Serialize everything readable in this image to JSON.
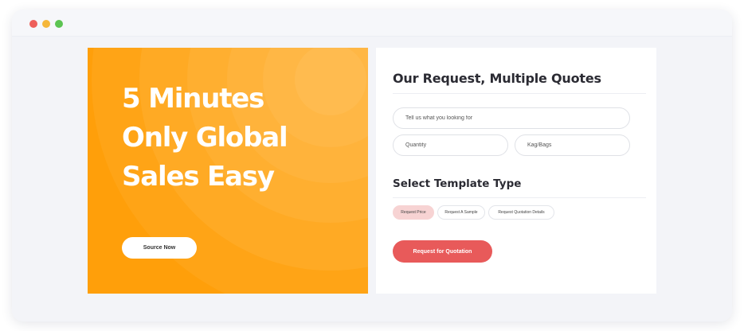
{
  "window": {
    "traffic_lights": [
      {
        "name": "close",
        "color": "#ee5f5b"
      },
      {
        "name": "minimize",
        "color": "#f5b73b"
      },
      {
        "name": "maximize",
        "color": "#5cc452"
      }
    ]
  },
  "hero": {
    "title_lines": [
      "5 Minutes",
      "Only Global",
      "Sales Easy"
    ],
    "button_label": "Source Now",
    "background_color": "#ff9f0a"
  },
  "request_form": {
    "title": "Our Request, Multiple Quotes",
    "search_placeholder": "Tell us what you looking for",
    "quantity_placeholder": "Quantity",
    "unit_placeholder": "Kag/Bags"
  },
  "template": {
    "title": "Select Template Type",
    "options": [
      {
        "label": "Request Price",
        "selected": true
      },
      {
        "label": "Request A Sample",
        "selected": false
      },
      {
        "label": "Request Quotation Details",
        "selected": false
      }
    ]
  },
  "submit": {
    "label": "Request for Quotation",
    "color": "#e85a5a"
  }
}
